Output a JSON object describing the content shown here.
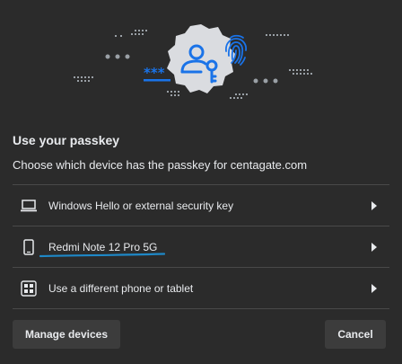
{
  "dialog": {
    "title": "Use your passkey",
    "subtitle": "Choose which device has the passkey for centagate.com",
    "hero_icons": [
      "person-key-icon",
      "fingerprint-icon",
      "password-dots-icon"
    ],
    "options": [
      {
        "label": "Windows Hello or external security key",
        "icon": "laptop-icon"
      },
      {
        "label": "Redmi Note 12 Pro 5G",
        "icon": "phone-icon"
      },
      {
        "label": "Use a different phone or tablet",
        "icon": "qr-code-icon"
      }
    ],
    "buttons": {
      "manage": "Manage devices",
      "cancel": "Cancel"
    }
  },
  "colors": {
    "background": "#2b2b2b",
    "accent": "#1a73e8",
    "badge": "#dadce0",
    "annotation": "#1e88c7"
  }
}
